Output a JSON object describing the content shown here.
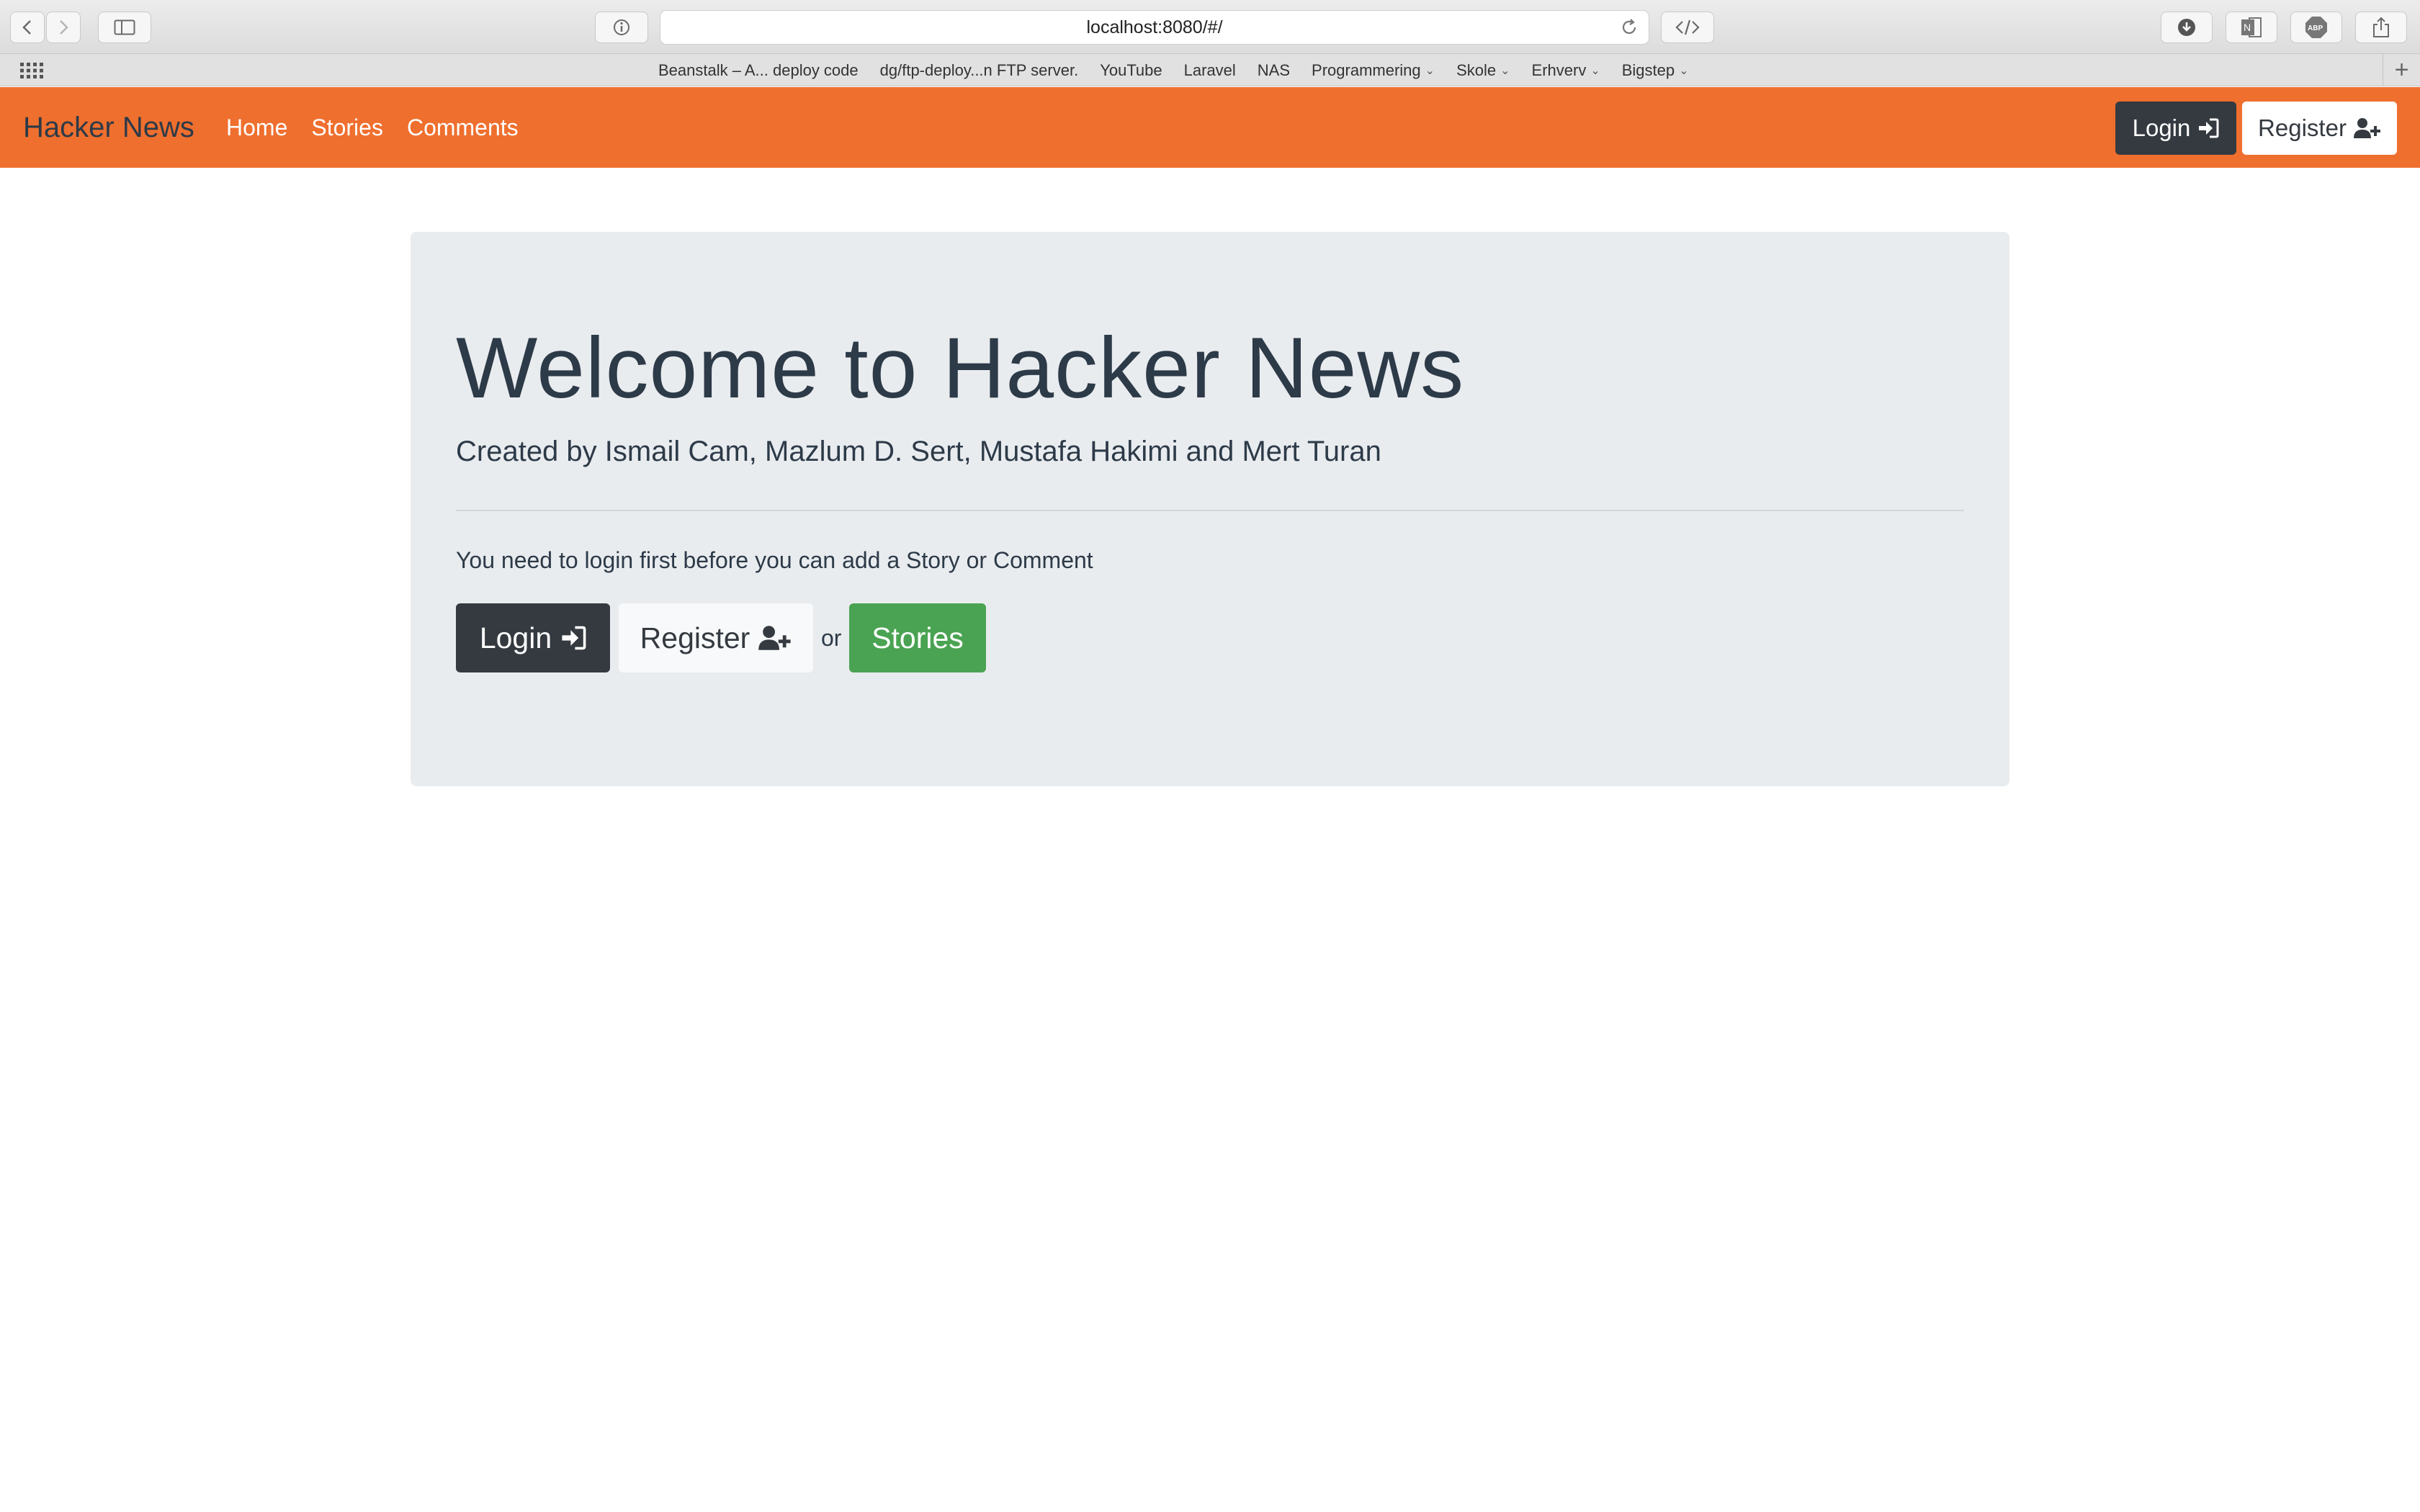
{
  "browser": {
    "url": "localhost:8080/#/",
    "bookmarks": [
      {
        "label": "Beanstalk – A... deploy code",
        "has_menu": false
      },
      {
        "label": "dg/ftp-deploy...n FTP server.",
        "has_menu": false
      },
      {
        "label": "YouTube",
        "has_menu": false
      },
      {
        "label": "Laravel",
        "has_menu": false
      },
      {
        "label": "NAS",
        "has_menu": false
      },
      {
        "label": "Programmering",
        "has_menu": true
      },
      {
        "label": "Skole",
        "has_menu": true
      },
      {
        "label": "Erhverv",
        "has_menu": true
      },
      {
        "label": "Bigstep",
        "has_menu": true
      }
    ],
    "toolbar_icons": [
      "back-icon",
      "forward-icon",
      "sidebar-icon",
      "info-icon",
      "reload-icon",
      "code-icon",
      "download-icon",
      "onenote-icon",
      "adblock-icon",
      "share-icon"
    ],
    "adblock_text": "ABP",
    "onenote_text": "N"
  },
  "navbar": {
    "brand": "Hacker News",
    "links": [
      "Home",
      "Stories",
      "Comments"
    ],
    "login_label": "Login",
    "register_label": "Register",
    "color": "#ef6f2e"
  },
  "jumbotron": {
    "title": "Welcome to Hacker News",
    "subtitle": "Created by Ismail Cam, Mazlum D. Sert, Mustafa Hakimi and Mert Turan",
    "note": "You need to login first before you can add a Story or Comment",
    "login_label": "Login",
    "register_label": "Register",
    "or_text": "or",
    "stories_label": "Stories"
  },
  "colors": {
    "dark": "#343a40",
    "light": "#f8f9fa",
    "success": "#4aa352",
    "text": "#2d3a48",
    "jumbotron_bg": "#e9ecef"
  }
}
